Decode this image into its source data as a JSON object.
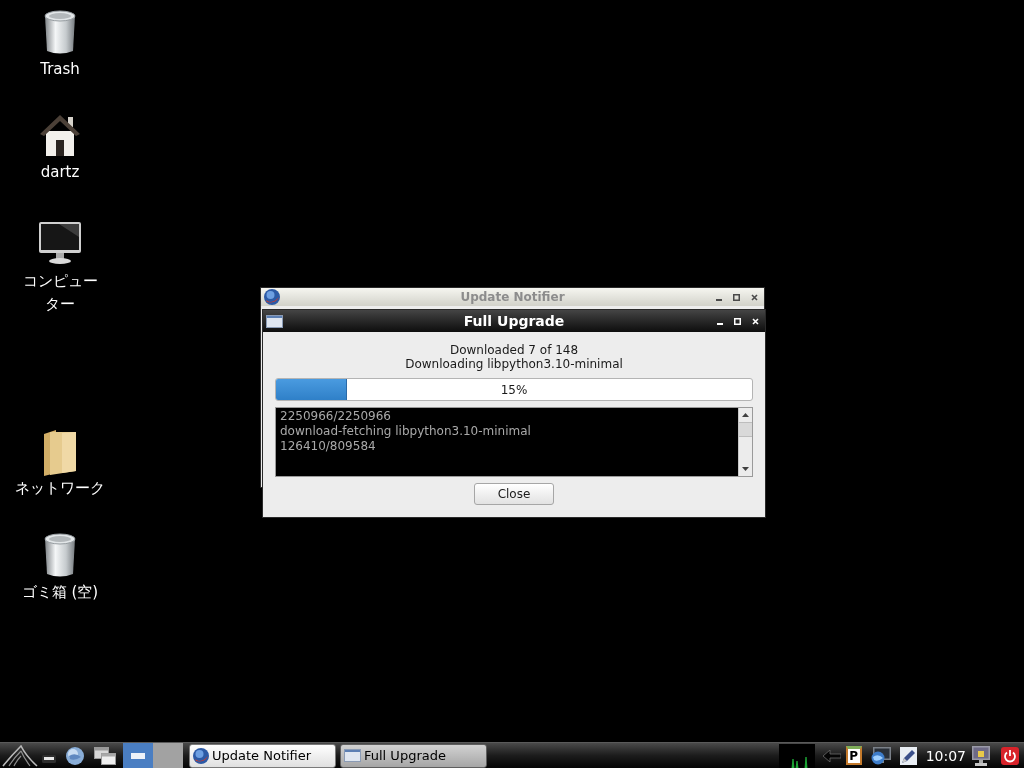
{
  "desktop_icons": [
    {
      "kind": "trash",
      "label": "Trash"
    },
    {
      "kind": "home",
      "label": "dartz"
    },
    {
      "kind": "computer",
      "label": "コンピューター"
    },
    {
      "kind": "folder",
      "label": "ネットワーク"
    },
    {
      "kind": "trash",
      "label": "ゴミ箱 (空)"
    }
  ],
  "windows": [
    {
      "kind": "app",
      "title": "Update Notifier",
      "focused": false
    },
    {
      "kind": "dialog",
      "title": "Full Upgrade",
      "focused": true,
      "status_lines": [
        "Downloaded 7 of 148",
        "Downloading libpython3.10-minimal"
      ],
      "progress": {
        "level": 0.15,
        "label": "15%"
      },
      "log_lines": [
        "2250966/2250966",
        "download-fetching libpython3.10-minimal",
        "126410/809584"
      ],
      "buttons": [
        "Close"
      ]
    }
  ],
  "taskbar": {
    "workspaces": [
      {
        "selected": true
      },
      {
        "selected": false
      }
    ],
    "tasks": [
      {
        "kind": "app",
        "label": "Update Notifier",
        "selected": false
      },
      {
        "kind": "dialog",
        "label": "Full Upgrade",
        "selected": true
      }
    ],
    "clipboard_label": "P",
    "clock": "10:07"
  }
}
